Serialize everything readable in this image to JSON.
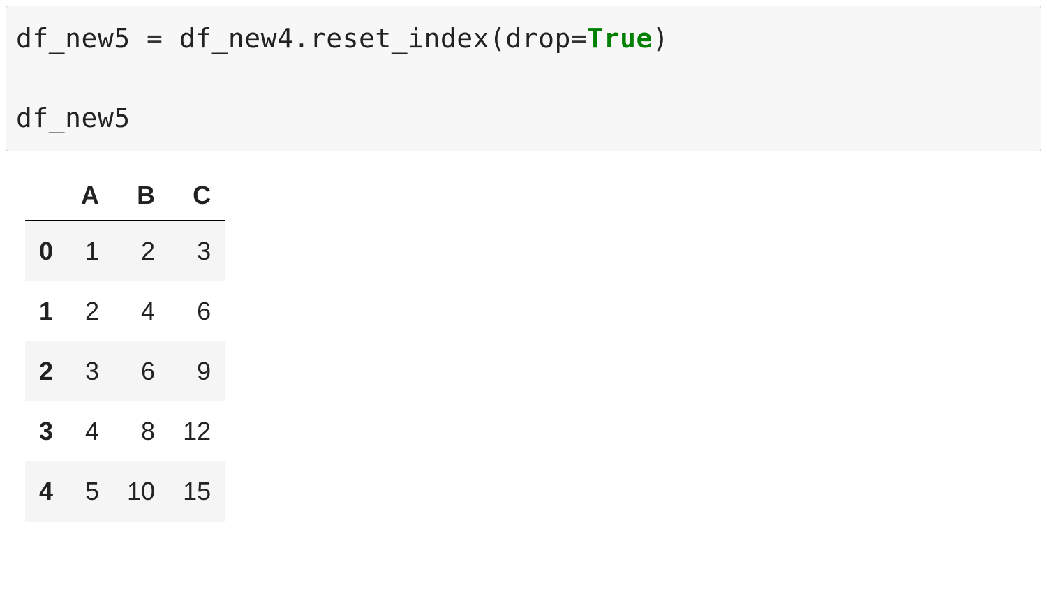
{
  "code": {
    "var1": "df_new5",
    "assign": " = ",
    "var2": "df_new4",
    "dot": ".",
    "method": "reset_index",
    "paren_open": "(",
    "kwarg_name": "drop",
    "kwarg_eq": "=",
    "kwarg_val": "True",
    "paren_close": ")",
    "line2": "df_new5"
  },
  "dataframe": {
    "columns": [
      "A",
      "B",
      "C"
    ],
    "index": [
      "0",
      "1",
      "2",
      "3",
      "4"
    ],
    "rows": [
      [
        "1",
        "2",
        "3"
      ],
      [
        "2",
        "4",
        "6"
      ],
      [
        "3",
        "6",
        "9"
      ],
      [
        "4",
        "8",
        "12"
      ],
      [
        "5",
        "10",
        "15"
      ]
    ]
  }
}
